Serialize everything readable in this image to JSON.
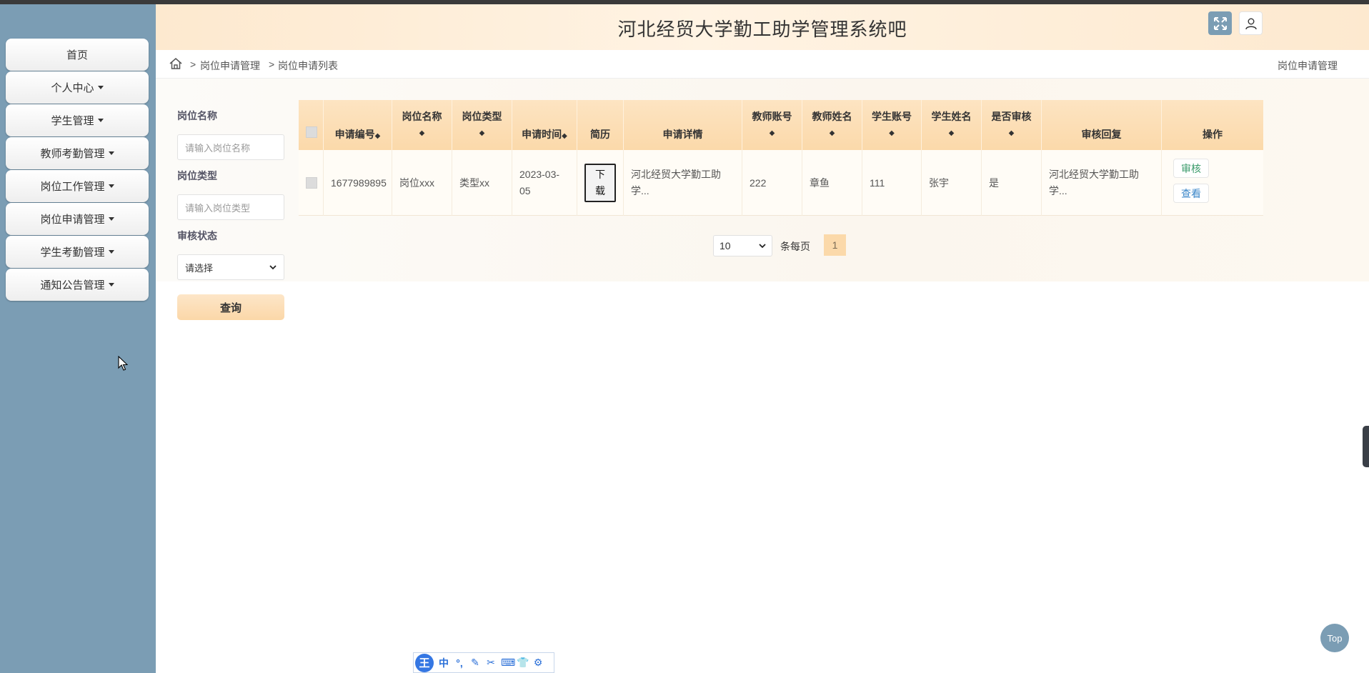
{
  "app": {
    "title": "河北经贸大学勤工助学管理系统吧"
  },
  "sidebar": {
    "items": [
      {
        "label": "首页",
        "has_caret": false
      },
      {
        "label": "个人中心",
        "has_caret": true
      },
      {
        "label": "学生管理",
        "has_caret": true
      },
      {
        "label": "教师考勤管理",
        "has_caret": true
      },
      {
        "label": "岗位工作管理",
        "has_caret": true
      },
      {
        "label": "岗位申请管理",
        "has_caret": true
      },
      {
        "label": "学生考勤管理",
        "has_caret": true
      },
      {
        "label": "通知公告管理",
        "has_caret": true
      }
    ]
  },
  "breadcrumb": {
    "sep": ">",
    "items": [
      "岗位申请管理",
      "岗位申请列表"
    ],
    "right_label": "岗位申请管理"
  },
  "filters": {
    "post_name": {
      "label": "岗位名称",
      "placeholder": "请输入岗位名称"
    },
    "post_type": {
      "label": "岗位类型",
      "placeholder": "请输入岗位类型"
    },
    "review_status": {
      "label": "审核状态",
      "selected": "请选择"
    },
    "query_label": "查询"
  },
  "table": {
    "headers": {
      "apply_no": "申请编号",
      "post_name": "岗位名称",
      "post_type": "岗位类型",
      "apply_time": "申请时间",
      "resume": "简历",
      "apply_detail": "申请详情",
      "teacher_account": "教师账号",
      "teacher_name": "教师姓名",
      "student_account": "学生账号",
      "student_name": "学生姓名",
      "reviewed": "是否审核",
      "review_reply": "审核回复",
      "actions": "操作"
    },
    "rows": [
      {
        "apply_no": "1677989895",
        "post_name": "岗位xxx",
        "post_type": "类型xx",
        "apply_time_l1": "2023-03-",
        "apply_time_l2": "05",
        "resume_btn_l1": "下",
        "resume_btn_l2": "载",
        "apply_detail_l1": "河北经贸大学勤工助",
        "apply_detail_l2": "学...",
        "teacher_account": "222",
        "teacher_name": "章鱼",
        "student_account": "111",
        "student_name": "张宇",
        "reviewed": "是",
        "review_reply_l1": "河北经贸大学勤工助",
        "review_reply_l2": "学...",
        "action_review": "审核",
        "action_view": "查看"
      }
    ]
  },
  "pagination": {
    "page_size": "10",
    "per_page_label": "条每页",
    "current_page": "1"
  },
  "ime": {
    "logo": "王",
    "mode": "中",
    "glyphs": [
      "°,",
      "✎",
      "✂",
      "⌨",
      "👕",
      "⚙"
    ]
  },
  "back_to_top": "Top",
  "colors": {
    "sidebar": "#7b9db4",
    "header": "#fde9cf",
    "table_header": "#fbd9aa",
    "review_action": "#3a9a6a",
    "view_action": "#3a86c8"
  }
}
